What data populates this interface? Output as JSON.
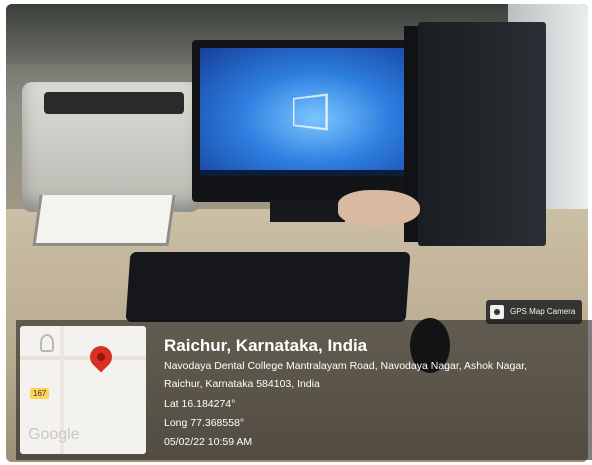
{
  "photo": {
    "description_icons": [
      "printer",
      "monitor",
      "computer-tower",
      "keyboard",
      "mouse"
    ]
  },
  "map_thumbnail": {
    "badge": "167",
    "brand": "Google"
  },
  "app_tag": {
    "label": "GPS Map Camera"
  },
  "location": {
    "title": "Raichur, Karnataka, India",
    "address_line1": "Navodaya Dental College Mantralayam Road, Navodaya Nagar, Ashok Nagar,",
    "address_line2": "Raichur, Karnataka 584103, India",
    "lat": "Lat 16.184274°",
    "long": "Long 77.368558°",
    "timestamp": "05/02/22 10:59 AM"
  },
  "colors": {
    "pin": "#d93025",
    "screen": "#2e7fe0",
    "overlay": "#141416"
  }
}
